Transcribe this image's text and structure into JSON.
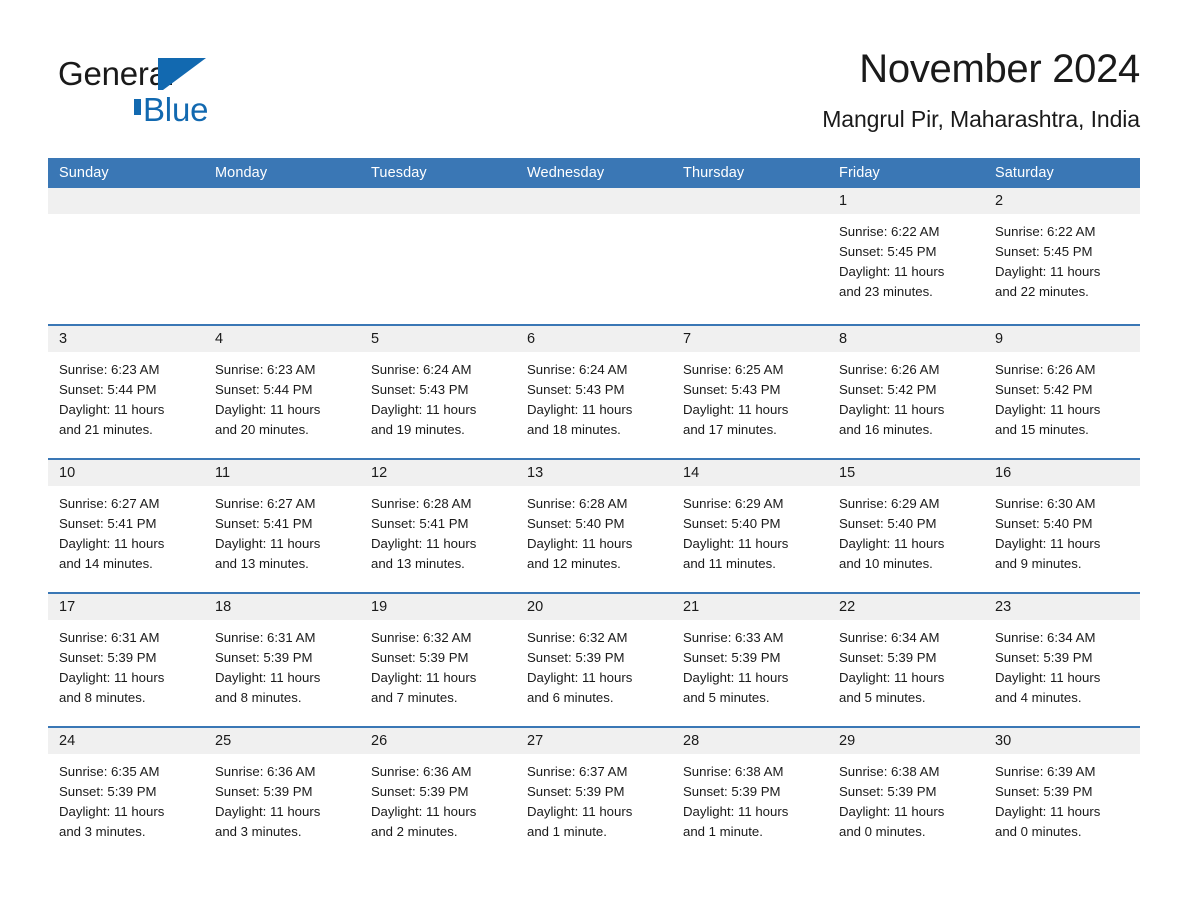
{
  "brand": {
    "name_part1": "General",
    "name_part2": "Blue",
    "triangle_color": "#1269b0",
    "accent_color": "#1269b0"
  },
  "header": {
    "title": "November 2024",
    "subtitle": "Mangrul Pir, Maharashtra, India"
  },
  "theme": {
    "header_blue": "#3a77b5",
    "day_band_gray": "#f0f0f0",
    "text_color": "#1a1a1a",
    "page_background": "#ffffff"
  },
  "weekdays": [
    "Sunday",
    "Monday",
    "Tuesday",
    "Wednesday",
    "Thursday",
    "Friday",
    "Saturday"
  ],
  "weeks": [
    [
      {
        "day": "",
        "sunrise": "",
        "sunset": "",
        "daylight": "",
        "daylight2": "",
        "empty": true
      },
      {
        "day": "",
        "sunrise": "",
        "sunset": "",
        "daylight": "",
        "daylight2": "",
        "empty": true
      },
      {
        "day": "",
        "sunrise": "",
        "sunset": "",
        "daylight": "",
        "daylight2": "",
        "empty": true
      },
      {
        "day": "",
        "sunrise": "",
        "sunset": "",
        "daylight": "",
        "daylight2": "",
        "empty": true
      },
      {
        "day": "",
        "sunrise": "",
        "sunset": "",
        "daylight": "",
        "daylight2": "",
        "empty": true
      },
      {
        "day": "1",
        "sunrise": "Sunrise: 6:22 AM",
        "sunset": "Sunset: 5:45 PM",
        "daylight": "Daylight: 11 hours",
        "daylight2": "and 23 minutes."
      },
      {
        "day": "2",
        "sunrise": "Sunrise: 6:22 AM",
        "sunset": "Sunset: 5:45 PM",
        "daylight": "Daylight: 11 hours",
        "daylight2": "and 22 minutes."
      }
    ],
    [
      {
        "day": "3",
        "sunrise": "Sunrise: 6:23 AM",
        "sunset": "Sunset: 5:44 PM",
        "daylight": "Daylight: 11 hours",
        "daylight2": "and 21 minutes."
      },
      {
        "day": "4",
        "sunrise": "Sunrise: 6:23 AM",
        "sunset": "Sunset: 5:44 PM",
        "daylight": "Daylight: 11 hours",
        "daylight2": "and 20 minutes."
      },
      {
        "day": "5",
        "sunrise": "Sunrise: 6:24 AM",
        "sunset": "Sunset: 5:43 PM",
        "daylight": "Daylight: 11 hours",
        "daylight2": "and 19 minutes."
      },
      {
        "day": "6",
        "sunrise": "Sunrise: 6:24 AM",
        "sunset": "Sunset: 5:43 PM",
        "daylight": "Daylight: 11 hours",
        "daylight2": "and 18 minutes."
      },
      {
        "day": "7",
        "sunrise": "Sunrise: 6:25 AM",
        "sunset": "Sunset: 5:43 PM",
        "daylight": "Daylight: 11 hours",
        "daylight2": "and 17 minutes."
      },
      {
        "day": "8",
        "sunrise": "Sunrise: 6:26 AM",
        "sunset": "Sunset: 5:42 PM",
        "daylight": "Daylight: 11 hours",
        "daylight2": "and 16 minutes."
      },
      {
        "day": "9",
        "sunrise": "Sunrise: 6:26 AM",
        "sunset": "Sunset: 5:42 PM",
        "daylight": "Daylight: 11 hours",
        "daylight2": "and 15 minutes."
      }
    ],
    [
      {
        "day": "10",
        "sunrise": "Sunrise: 6:27 AM",
        "sunset": "Sunset: 5:41 PM",
        "daylight": "Daylight: 11 hours",
        "daylight2": "and 14 minutes."
      },
      {
        "day": "11",
        "sunrise": "Sunrise: 6:27 AM",
        "sunset": "Sunset: 5:41 PM",
        "daylight": "Daylight: 11 hours",
        "daylight2": "and 13 minutes."
      },
      {
        "day": "12",
        "sunrise": "Sunrise: 6:28 AM",
        "sunset": "Sunset: 5:41 PM",
        "daylight": "Daylight: 11 hours",
        "daylight2": "and 13 minutes."
      },
      {
        "day": "13",
        "sunrise": "Sunrise: 6:28 AM",
        "sunset": "Sunset: 5:40 PM",
        "daylight": "Daylight: 11 hours",
        "daylight2": "and 12 minutes."
      },
      {
        "day": "14",
        "sunrise": "Sunrise: 6:29 AM",
        "sunset": "Sunset: 5:40 PM",
        "daylight": "Daylight: 11 hours",
        "daylight2": "and 11 minutes."
      },
      {
        "day": "15",
        "sunrise": "Sunrise: 6:29 AM",
        "sunset": "Sunset: 5:40 PM",
        "daylight": "Daylight: 11 hours",
        "daylight2": "and 10 minutes."
      },
      {
        "day": "16",
        "sunrise": "Sunrise: 6:30 AM",
        "sunset": "Sunset: 5:40 PM",
        "daylight": "Daylight: 11 hours",
        "daylight2": "and 9 minutes."
      }
    ],
    [
      {
        "day": "17",
        "sunrise": "Sunrise: 6:31 AM",
        "sunset": "Sunset: 5:39 PM",
        "daylight": "Daylight: 11 hours",
        "daylight2": "and 8 minutes."
      },
      {
        "day": "18",
        "sunrise": "Sunrise: 6:31 AM",
        "sunset": "Sunset: 5:39 PM",
        "daylight": "Daylight: 11 hours",
        "daylight2": "and 8 minutes."
      },
      {
        "day": "19",
        "sunrise": "Sunrise: 6:32 AM",
        "sunset": "Sunset: 5:39 PM",
        "daylight": "Daylight: 11 hours",
        "daylight2": "and 7 minutes."
      },
      {
        "day": "20",
        "sunrise": "Sunrise: 6:32 AM",
        "sunset": "Sunset: 5:39 PM",
        "daylight": "Daylight: 11 hours",
        "daylight2": "and 6 minutes."
      },
      {
        "day": "21",
        "sunrise": "Sunrise: 6:33 AM",
        "sunset": "Sunset: 5:39 PM",
        "daylight": "Daylight: 11 hours",
        "daylight2": "and 5 minutes."
      },
      {
        "day": "22",
        "sunrise": "Sunrise: 6:34 AM",
        "sunset": "Sunset: 5:39 PM",
        "daylight": "Daylight: 11 hours",
        "daylight2": "and 5 minutes."
      },
      {
        "day": "23",
        "sunrise": "Sunrise: 6:34 AM",
        "sunset": "Sunset: 5:39 PM",
        "daylight": "Daylight: 11 hours",
        "daylight2": "and 4 minutes."
      }
    ],
    [
      {
        "day": "24",
        "sunrise": "Sunrise: 6:35 AM",
        "sunset": "Sunset: 5:39 PM",
        "daylight": "Daylight: 11 hours",
        "daylight2": "and 3 minutes."
      },
      {
        "day": "25",
        "sunrise": "Sunrise: 6:36 AM",
        "sunset": "Sunset: 5:39 PM",
        "daylight": "Daylight: 11 hours",
        "daylight2": "and 3 minutes."
      },
      {
        "day": "26",
        "sunrise": "Sunrise: 6:36 AM",
        "sunset": "Sunset: 5:39 PM",
        "daylight": "Daylight: 11 hours",
        "daylight2": "and 2 minutes."
      },
      {
        "day": "27",
        "sunrise": "Sunrise: 6:37 AM",
        "sunset": "Sunset: 5:39 PM",
        "daylight": "Daylight: 11 hours",
        "daylight2": "and 1 minute."
      },
      {
        "day": "28",
        "sunrise": "Sunrise: 6:38 AM",
        "sunset": "Sunset: 5:39 PM",
        "daylight": "Daylight: 11 hours",
        "daylight2": "and 1 minute."
      },
      {
        "day": "29",
        "sunrise": "Sunrise: 6:38 AM",
        "sunset": "Sunset: 5:39 PM",
        "daylight": "Daylight: 11 hours",
        "daylight2": "and 0 minutes."
      },
      {
        "day": "30",
        "sunrise": "Sunrise: 6:39 AM",
        "sunset": "Sunset: 5:39 PM",
        "daylight": "Daylight: 11 hours",
        "daylight2": "and 0 minutes."
      }
    ]
  ]
}
